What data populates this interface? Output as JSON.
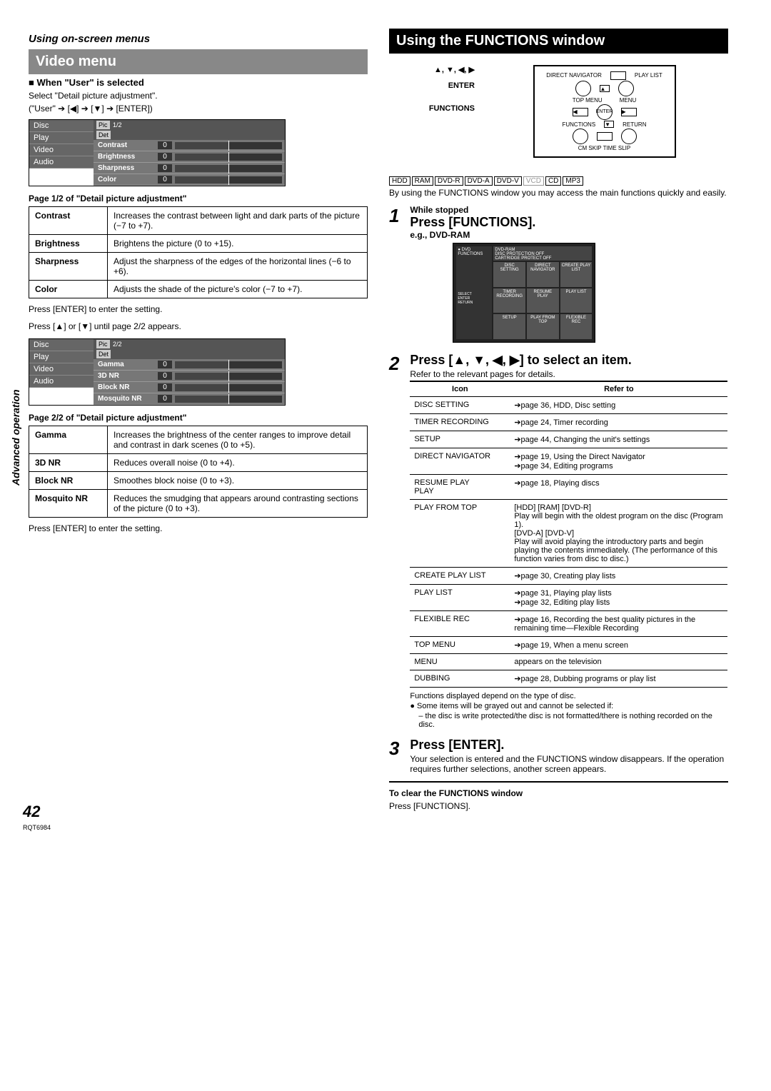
{
  "left": {
    "top_heading": "Using on-screen menus",
    "video_menu": "Video menu",
    "when_user": "When \"User\" is selected",
    "select_detail": "Select \"Detail picture adjustment\".",
    "path": "(\"User\" ➔ [◀] ➔ [▼] ➔ [ENTER])",
    "osd_pages": [
      "Disc",
      "Play",
      "Video",
      "Audio"
    ],
    "osd_tag_pic": "Pic",
    "osd_tag_det": "Det",
    "osd1_page": "1/2",
    "osd1_rows": [
      {
        "label": "Contrast",
        "val": "0"
      },
      {
        "label": "Brightness",
        "val": "0"
      },
      {
        "label": "Sharpness",
        "val": "0"
      },
      {
        "label": "Color",
        "val": "0"
      }
    ],
    "page1_caption": "Page 1/2 of \"Detail picture adjustment\"",
    "table1": [
      {
        "name": "Contrast",
        "desc": "Increases the contrast between light and dark parts of the picture (−7 to +7)."
      },
      {
        "name": "Brightness",
        "desc": "Brightens the picture (0 to +15)."
      },
      {
        "name": "Sharpness",
        "desc": "Adjust the sharpness of the edges of the horizontal lines (−6 to +6)."
      },
      {
        "name": "Color",
        "desc": "Adjusts the shade of the picture's color (−7 to +7)."
      }
    ],
    "enter_note1": "Press [ENTER] to enter the setting.",
    "page_nav_note": "Press [▲] or [▼] until page 2/2 appears.",
    "osd2_page": "2/2",
    "osd2_rows": [
      {
        "label": "Gamma",
        "val": "0"
      },
      {
        "label": "3D NR",
        "val": "0"
      },
      {
        "label": "Block NR",
        "val": "0"
      },
      {
        "label": "Mosquito NR",
        "val": "0"
      }
    ],
    "page2_caption": "Page 2/2 of \"Detail picture adjustment\"",
    "table2": [
      {
        "name": "Gamma",
        "desc": "Increases the brightness of the center ranges to improve detail and contrast in dark scenes (0 to +5)."
      },
      {
        "name": "3D NR",
        "desc": "Reduces overall noise (0 to +4)."
      },
      {
        "name": "Block NR",
        "desc": "Smoothes block noise (0 to +3)."
      },
      {
        "name": "Mosquito NR",
        "desc": "Reduces the smudging that appears around contrasting sections of the picture (0 to +3)."
      }
    ],
    "enter_note2": "Press [ENTER] to enter the setting."
  },
  "right": {
    "heading": "Using the FUNCTIONS window",
    "pointer_arrows": "▲, ▼, ◀, ▶",
    "pointer_enter": "ENTER",
    "pointer_functions": "FUNCTIONS",
    "remote_labels": {
      "dn": "DIRECT NAVIGATOR",
      "pl": "PLAY LIST",
      "tm": "TOP MENU",
      "mn": "MENU",
      "en": "ENTER",
      "fn": "FUNCTIONS",
      "rt": "RETURN",
      "sk": "CM SKIP   TIME SLIP"
    },
    "media": [
      "HDD",
      "RAM",
      "DVD-R",
      "DVD-A",
      "DVD-V",
      "VCD",
      "CD",
      "MP3"
    ],
    "intro": "By using the FUNCTIONS window you may access the main functions quickly and easily.",
    "step1_sub": "While stopped",
    "step1_title": "Press [FUNCTIONS].",
    "step1_eg": "e.g., DVD-RAM",
    "func_shot": {
      "side_top": "● DVD",
      "side_fn": "FUNCTIONS",
      "hdr1": "DVD-RAM",
      "hdr2": "DISC PROTECTION OFF",
      "hdr3": "CARTRIDGE PROTECT OFF",
      "cells": [
        "DISC SETTING",
        "DIRECT NAVIGATOR",
        "CREATE PLAY LIST",
        "TIMER RECORDING",
        "RESUME PLAY",
        "PLAY LIST",
        "SETUP",
        "PLAY FROM TOP",
        "FLEXIBLE REC"
      ],
      "select": "SELECT",
      "enter": "ENTER",
      "return": "RETURN"
    },
    "step2_title": "Press [▲, ▼, ◀, ▶] to select an item.",
    "step2_sub": "Refer to the relevant pages for details.",
    "ref_th1": "Icon",
    "ref_th2": "Refer to",
    "ref_rows": [
      {
        "icon": "DISC SETTING",
        "ref": "➔page 36, HDD, Disc setting"
      },
      {
        "icon": "TIMER RECORDING",
        "ref": "➔page 24, Timer recording"
      },
      {
        "icon": "SETUP",
        "ref": "➔page 44, Changing the unit's settings"
      },
      {
        "icon": "DIRECT NAVIGATOR",
        "ref": "➔page 19, Using the Direct Navigator\n➔page 34, Editing programs"
      },
      {
        "icon": "RESUME PLAY\nPLAY",
        "ref": "➔page 18, Playing discs"
      },
      {
        "icon": "PLAY FROM TOP",
        "ref": "[HDD] [RAM] [DVD-R]\nPlay will begin with the oldest program on the disc (Program 1).\n[DVD-A] [DVD-V]\nPlay will avoid playing the introductory parts and begin playing the contents immediately. (The performance of this function varies from disc to disc.)"
      },
      {
        "icon": "CREATE PLAY LIST",
        "ref": "➔page 30, Creating play lists"
      },
      {
        "icon": "PLAY LIST",
        "ref": "➔page 31, Playing play lists\n➔page 32, Editing play lists"
      },
      {
        "icon": "FLEXIBLE REC",
        "ref": "➔page 16, Recording the best quality pictures in the remaining time—Flexible Recording"
      },
      {
        "icon": "TOP MENU",
        "ref": "➔page 19, When a menu screen"
      },
      {
        "icon": "MENU",
        "ref": "appears on the television"
      },
      {
        "icon": "DUBBING",
        "ref": "➔page 28, Dubbing programs or play list"
      }
    ],
    "after_notes": [
      "Functions displayed depend on the type of disc.",
      "● Some items will be grayed out and cannot be selected if:",
      "– the disc is write protected/the disc is not formatted/there is nothing recorded on the disc."
    ],
    "step3_title": "Press [ENTER].",
    "step3_body": "Your selection is entered and the FUNCTIONS window disappears. If the operation requires further selections, another screen appears.",
    "clear_heading": "To clear the FUNCTIONS window",
    "clear_body": "Press [FUNCTIONS]."
  },
  "side_label": "Advanced operation",
  "page_num": "42",
  "rqt": "RQT6984"
}
